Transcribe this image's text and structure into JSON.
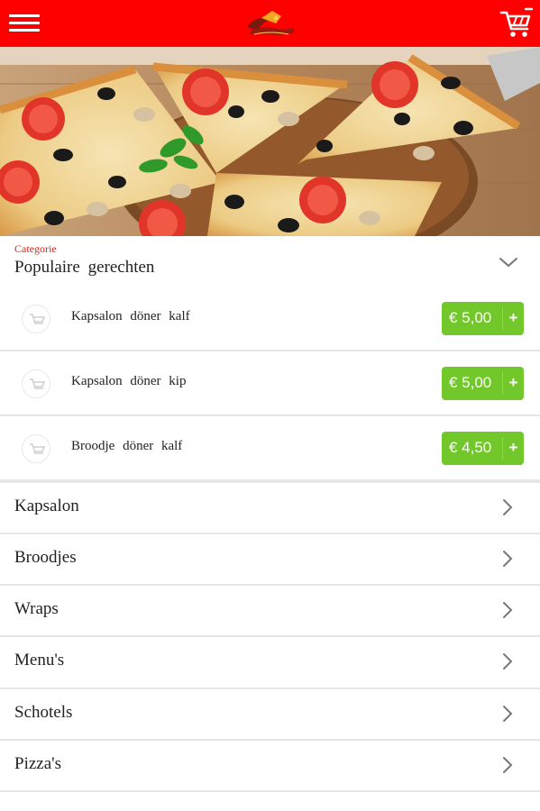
{
  "header": {
    "menu_icon": "hamburger-menu-icon",
    "logo": "restaurant-logo",
    "cart_icon": "shopping-cart-icon",
    "brand_color": "#ff0000"
  },
  "hero": {
    "image": "pizza-photo"
  },
  "category": {
    "label": "Categorie",
    "value": "Populaire   gerechten",
    "label_color": "#e2231a"
  },
  "popular_items": [
    {
      "name": "Kapsalon  döner  kalf",
      "price": "€ 5,00",
      "add": "+"
    },
    {
      "name": "Kapsalon  döner  kip",
      "price": "€ 5,00",
      "add": "+"
    },
    {
      "name": "Broodje  döner  kalf",
      "price": "€ 4,50",
      "add": "+"
    }
  ],
  "price_button_color": "#72c72a",
  "categories": [
    {
      "label": "Kapsalon"
    },
    {
      "label": "Broodjes"
    },
    {
      "label": "Wraps"
    },
    {
      "label": "Menu's"
    },
    {
      "label": "Schotels"
    },
    {
      "label": "Pizza's"
    }
  ]
}
